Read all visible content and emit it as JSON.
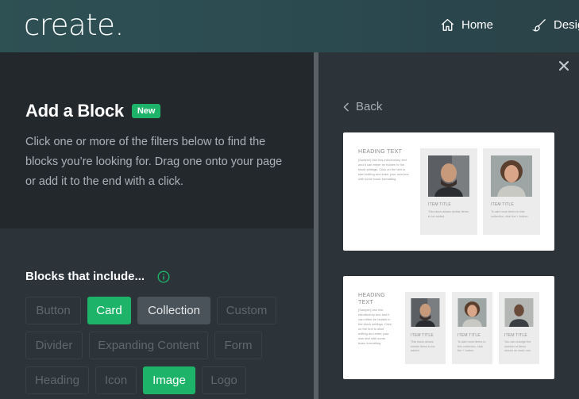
{
  "app": {
    "logo": "create.",
    "nav": [
      {
        "label": "Home",
        "icon": "home-icon"
      },
      {
        "label": "Desig",
        "icon": "brush-icon"
      }
    ]
  },
  "panel": {
    "title": "Add a Block",
    "badge": "New",
    "description": "Click one or more of the filters below to find the blocks you’re looking for. Drag one onto your page or add it to the end with a click.",
    "filters_title": "Blocks that include...",
    "filters": [
      {
        "label": "Button",
        "state": "default"
      },
      {
        "label": "Card",
        "state": "selected"
      },
      {
        "label": "Collection",
        "state": "highlight"
      },
      {
        "label": "Custom",
        "state": "default"
      },
      {
        "label": "Divider",
        "state": "default"
      },
      {
        "label": "Expanding Content",
        "state": "default"
      },
      {
        "label": "Form",
        "state": "default"
      },
      {
        "label": "Heading",
        "state": "default"
      },
      {
        "label": "Icon",
        "state": "default"
      },
      {
        "label": "Image",
        "state": "selected"
      },
      {
        "label": "Logo",
        "state": "default"
      }
    ]
  },
  "preview_panel": {
    "back_label": "Back",
    "blocks": [
      {
        "heading": "HEADING TEXT",
        "text": "[Sample] Use this introductory text and it can either be hidden in the block settings. Click on the text to start editing and enter your own text with some basic formatting.",
        "cards": [
          {
            "title": "ITEM TITLE",
            "text": "This block allows similar items to be added."
          },
          {
            "title": "ITEM TITLE",
            "text": "To add more items to this collection, click the + button."
          }
        ]
      },
      {
        "heading": "HEADING TEXT",
        "text": "[Sample] Use this introductory text and it can either be hidden in the block settings. Click on the text to start editing and enter your own text with some basic formatting.",
        "cards": [
          {
            "title": "ITEM TITLE",
            "text": "This block allows similar items to be added."
          },
          {
            "title": "ITEM TITLE",
            "text": "To add more items to this collection, click the + button."
          },
          {
            "title": "ITEM TITLE",
            "text": "You can change the number of items shown on each row."
          }
        ]
      }
    ]
  },
  "colors": {
    "accent_green": "#1db46a",
    "topbar": "#2e5154",
    "panel_dark": "#23282d",
    "panel": "#2c3339"
  }
}
